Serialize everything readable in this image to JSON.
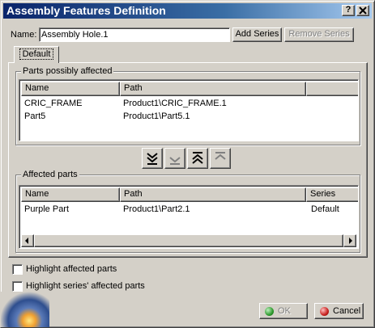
{
  "window": {
    "title": "Assembly Features Definition",
    "help_label": "?",
    "close_label": "X"
  },
  "name_field": {
    "label": "Name:",
    "value": "Assembly Hole.1"
  },
  "buttons": {
    "add_series": "Add Series",
    "remove_series": "Remove Series",
    "ok": "OK",
    "cancel": "Cancel"
  },
  "tab": {
    "label": "Default"
  },
  "parts_possibly_affected": {
    "title": "Parts possibly affected",
    "columns": [
      "Name",
      "Path",
      ""
    ],
    "rows": [
      {
        "name": "CRIC_FRAME",
        "path": "Product1\\CRIC_FRAME.1"
      },
      {
        "name": "Part5",
        "path": "Product1\\Part5.1"
      }
    ]
  },
  "transfer_buttons": [
    {
      "icon": "move-all-down-icon"
    },
    {
      "icon": "move-down-icon"
    },
    {
      "icon": "move-all-up-icon"
    },
    {
      "icon": "move-up-icon"
    }
  ],
  "affected_parts": {
    "title": "Affected parts",
    "columns": [
      "Name",
      "Path",
      "Series"
    ],
    "rows": [
      {
        "name": "Purple Part",
        "path": "Product1\\Part2.1",
        "series": "Default"
      }
    ]
  },
  "checkboxes": [
    {
      "label": "Highlight affected parts",
      "checked": false
    },
    {
      "label": "Highlight series' affected parts",
      "checked": false
    }
  ],
  "colors": {
    "ok_icon": "#2e9a2e",
    "cancel_icon": "#c8201e",
    "title_bar": "#0a246a"
  }
}
